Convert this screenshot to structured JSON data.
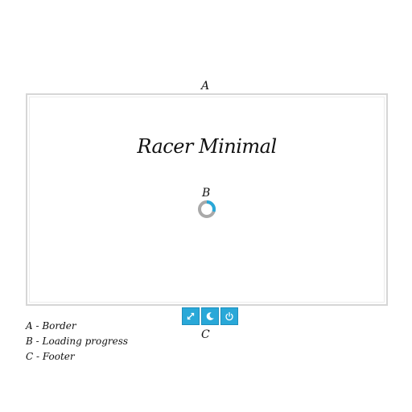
{
  "labels": {
    "border": "A",
    "progress": "B",
    "footer": "C"
  },
  "game": {
    "title": "Racer Minimal"
  },
  "loading": {
    "progress": 0.3,
    "track_color": "#a9a9a9",
    "fill_color": "#29a8d8"
  },
  "footer": {
    "accent": "#29a8d8",
    "buttons": [
      {
        "icon": "fullscreen-icon"
      },
      {
        "icon": "night-mode-moon-icon"
      },
      {
        "icon": "power-icon"
      }
    ]
  },
  "legend": [
    "A - Border",
    "B - Loading progress",
    "C - Footer"
  ]
}
